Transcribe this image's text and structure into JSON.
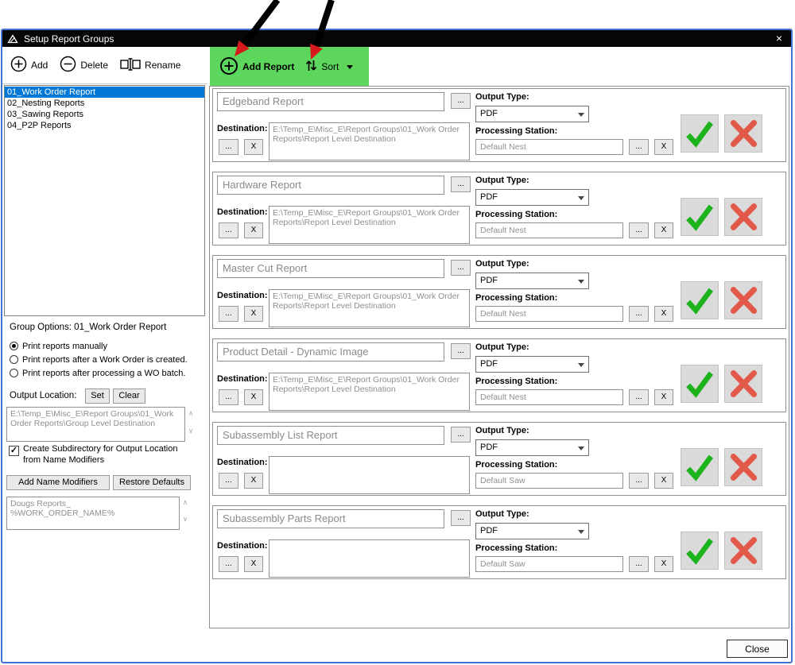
{
  "window": {
    "title": "Setup Report Groups",
    "close": "×"
  },
  "toolbar": {
    "add": "Add",
    "delete": "Delete",
    "rename": "Rename",
    "add_report": "Add Report",
    "sort": "Sort"
  },
  "group_list": [
    "01_Work Order Report",
    "02_Nesting Reports",
    "03_Sawing Reports",
    "04_P2P Reports"
  ],
  "options": {
    "title": "Group Options: 01_Work Order Report",
    "radio1": "Print reports manually",
    "radio2": "Print reports after a Work Order is created.",
    "radio3": "Print reports after processing a WO batch.",
    "output_location": "Output Location:",
    "set": "Set",
    "clear": "Clear",
    "location_value": "E:\\Temp_E\\Misc_E\\Report Groups\\01_Work Order Reports\\Group Level Destination",
    "subdir_label": "Create Subdirectory for Output Location from Name Modifiers",
    "add_name_modifiers": "Add Name Modifiers",
    "restore_defaults": "Restore Defaults",
    "modifiers_value": "Dougs Reports_\n%WORK_ORDER_NAME%"
  },
  "report_labels": {
    "output_type": "Output Type:",
    "destination": "Destination:",
    "processing_station": "Processing Station:",
    "browse": "...",
    "remove": "X"
  },
  "reports": [
    {
      "name": "Edgeband Report",
      "output_type": "PDF",
      "destination": "E:\\Temp_E\\Misc_E\\Report Groups\\01_Work Order Reports\\Report Level Destination",
      "station": "Default Nest"
    },
    {
      "name": "Hardware Report",
      "output_type": "PDF",
      "destination": "E:\\Temp_E\\Misc_E\\Report Groups\\01_Work Order Reports\\Report Level Destination",
      "station": "Default Nest"
    },
    {
      "name": "Master Cut Report",
      "output_type": "PDF",
      "destination": "E:\\Temp_E\\Misc_E\\Report Groups\\01_Work Order Reports\\Report Level Destination",
      "station": "Default Nest"
    },
    {
      "name": "Product Detail - Dynamic Image",
      "output_type": "PDF",
      "destination": "E:\\Temp_E\\Misc_E\\Report Groups\\01_Work Order Reports\\Report Level Destination",
      "station": "Default Nest"
    },
    {
      "name": "Subassembly List Report",
      "output_type": "PDF",
      "destination": "",
      "station": "Default Saw"
    },
    {
      "name": "Subassembly Parts Report",
      "output_type": "PDF",
      "destination": "",
      "station": "Default Saw"
    }
  ],
  "footer": {
    "close": "Close"
  },
  "glyphs": {
    "up": "∧",
    "down": "∨",
    "check": "✓"
  },
  "colors": {
    "highlight_green": "#5cd65c",
    "selection_blue": "#0078d7",
    "check_green": "#1db31d",
    "x_red": "#e2594a",
    "window_border": "#4673d1"
  }
}
